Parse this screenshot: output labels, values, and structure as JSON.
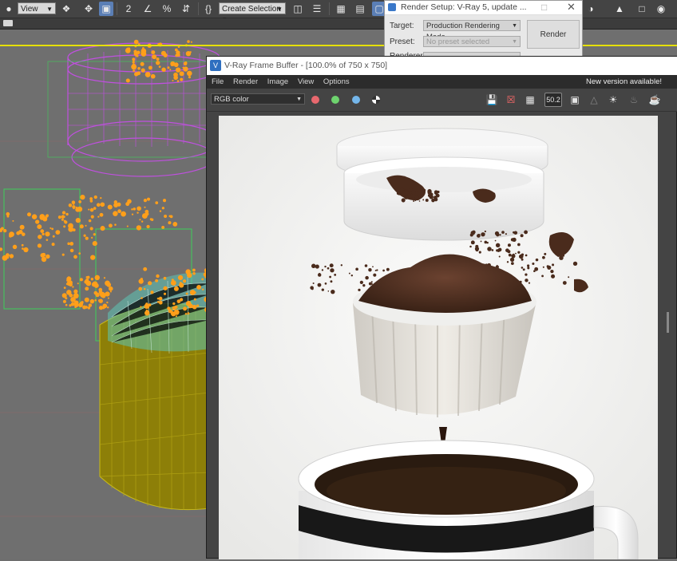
{
  "toolbar": {
    "view_dropdown": "View",
    "selection_set_dropdown": "Create Selection Se",
    "snap_label": "2",
    "percent_snap_label": "%",
    "angle_snap_label": "∠"
  },
  "render_setup": {
    "title": "Render Setup: V-Ray 5, update ...",
    "target_label": "Target:",
    "target_value": "Production Rendering Mode",
    "preset_label": "Preset:",
    "preset_value": "No preset selected",
    "renderer_label": "Renderer:",
    "render_button": "Render"
  },
  "vfb": {
    "title": "V-Ray Frame Buffer - [100.0% of 750 x 750]",
    "menu": [
      "File",
      "Render",
      "Image",
      "View",
      "Options"
    ],
    "update_notice": "New version available!",
    "channel_dropdown": "RGB color",
    "zoom_badge": "50.2"
  },
  "colors": {
    "accent_blue": "#5b7fb6",
    "channel_red": "#e8686e",
    "channel_green": "#6ed36e",
    "channel_blue": "#74b6ea",
    "viewport_border": "#e5e000",
    "wire_magenta": "#c050e0",
    "wire_orange": "#ff9f1a",
    "wire_olive": "#9a8e05",
    "wire_teal": "#6fd9c9"
  },
  "icons": [
    "select-object-icon",
    "move-icon",
    "rotate-icon",
    "scale-icon",
    "snap-icon",
    "percent-snap-icon",
    "spinner-snap-icon",
    "mirror-icon",
    "align-icon",
    "layer-icon",
    "ribbon-icon",
    "save-icon",
    "clear-icon",
    "region-render-icon",
    "teapot-render-icon"
  ]
}
